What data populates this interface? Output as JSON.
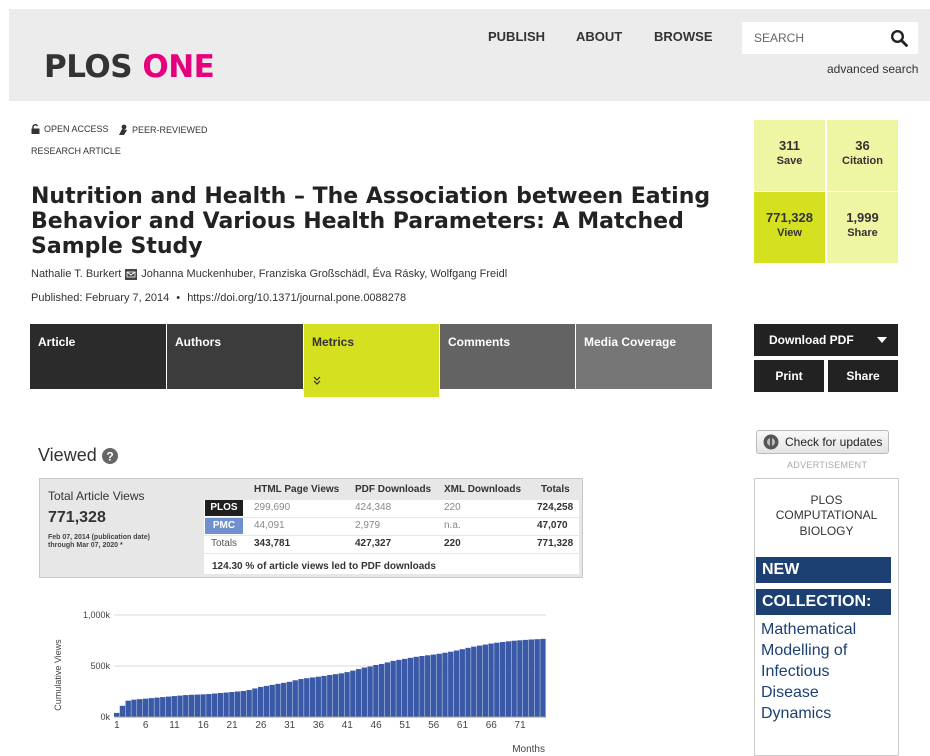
{
  "header": {
    "logo_part1": "PLOS",
    "logo_part2": "ONE",
    "nav": [
      "PUBLISH",
      "ABOUT",
      "BROWSE"
    ],
    "search_placeholder": "SEARCH",
    "advanced_search": "advanced search"
  },
  "article": {
    "open_access": "OPEN ACCESS",
    "peer_reviewed": "PEER-REVIEWED",
    "type": "RESEARCH ARTICLE",
    "title": "Nutrition and Health – The Association between Eating Behavior and Various Health Parameters: A Matched Sample Study",
    "authors": [
      "Nathalie T. Burkert",
      "Johanna Muckenhuber,",
      "Franziska Großschädl,",
      "Éva Rásky,",
      "Wolfgang Freidl"
    ],
    "published": "Published: February 7, 2014",
    "bullet": "•",
    "doi": "https://doi.org/10.1371/journal.pone.0088278"
  },
  "tabs": [
    "Article",
    "Authors",
    "Metrics",
    "Comments",
    "Media Coverage"
  ],
  "metrics": {
    "save": {
      "value": "311",
      "label": "Save"
    },
    "citation": {
      "value": "36",
      "label": "Citation"
    },
    "view": {
      "value": "771,328",
      "label": "View"
    },
    "share": {
      "value": "1,999",
      "label": "Share"
    }
  },
  "actions": {
    "download_pdf": "Download PDF",
    "print": "Print",
    "share": "Share",
    "check_updates": "Check for updates",
    "advertisement": "ADVERTISEMENT"
  },
  "ad": {
    "line1": "PLOS",
    "line2": "COMPUTATIONAL",
    "line3": "BIOLOGY",
    "band1": "NEW",
    "band2": "COLLECTION:",
    "blue_lines": [
      "Mathematical",
      "Modelling of",
      "Infectious",
      "Disease",
      "Dynamics"
    ]
  },
  "viewed": {
    "heading": "Viewed",
    "total_label": "Total Article Views",
    "total_value": "771,328",
    "range_line1": "Feb 07, 2014 (publication date)",
    "range_line2": "through Mar 07, 2020 *",
    "columns": [
      "HTML Page Views",
      "PDF Downloads",
      "XML Downloads",
      "Totals"
    ],
    "rows": [
      {
        "label": "PLOS",
        "html": "299,690",
        "pdf": "424,348",
        "xml": "220",
        "total": "724,258"
      },
      {
        "label": "PMC",
        "html": "44,091",
        "pdf": "2,979",
        "xml": "n.a.",
        "total": "47,070"
      },
      {
        "label": "Totals",
        "html": "343,781",
        "pdf": "427,327",
        "xml": "220",
        "total": "771,328"
      }
    ],
    "pdf_note": "124.30 % of article views led to PDF downloads",
    "colors": {
      "plos": "#1f1f1f",
      "pmc": "#6f8fcf"
    }
  },
  "chart_data": {
    "type": "bar",
    "ylabel": "Cumulative Views",
    "xlabel": "Months",
    "ylim": [
      0,
      1000000
    ],
    "y_ticks": [
      "0k",
      "500k",
      "1,000k"
    ],
    "x_ticks": [
      "1",
      "6",
      "11",
      "16",
      "21",
      "26",
      "31",
      "36",
      "41",
      "46",
      "51",
      "56",
      "61",
      "66",
      "71"
    ],
    "bar_color": "#3a5aa8",
    "values": [
      40000,
      110000,
      160000,
      170000,
      175000,
      180000,
      185000,
      190000,
      195000,
      200000,
      205000,
      210000,
      215000,
      218000,
      220000,
      222000,
      225000,
      230000,
      235000,
      240000,
      245000,
      250000,
      255000,
      265000,
      280000,
      295000,
      305000,
      315000,
      325000,
      335000,
      345000,
      360000,
      372000,
      380000,
      388000,
      395000,
      403000,
      412000,
      420000,
      428000,
      440000,
      455000,
      470000,
      485000,
      495000,
      510000,
      520000,
      535000,
      550000,
      560000,
      570000,
      580000,
      590000,
      598000,
      605000,
      612000,
      620000,
      630000,
      640000,
      652000,
      665000,
      678000,
      690000,
      700000,
      710000,
      720000,
      728000,
      735000,
      742000,
      748000,
      752000,
      756000,
      760000,
      763000,
      766000
    ]
  }
}
